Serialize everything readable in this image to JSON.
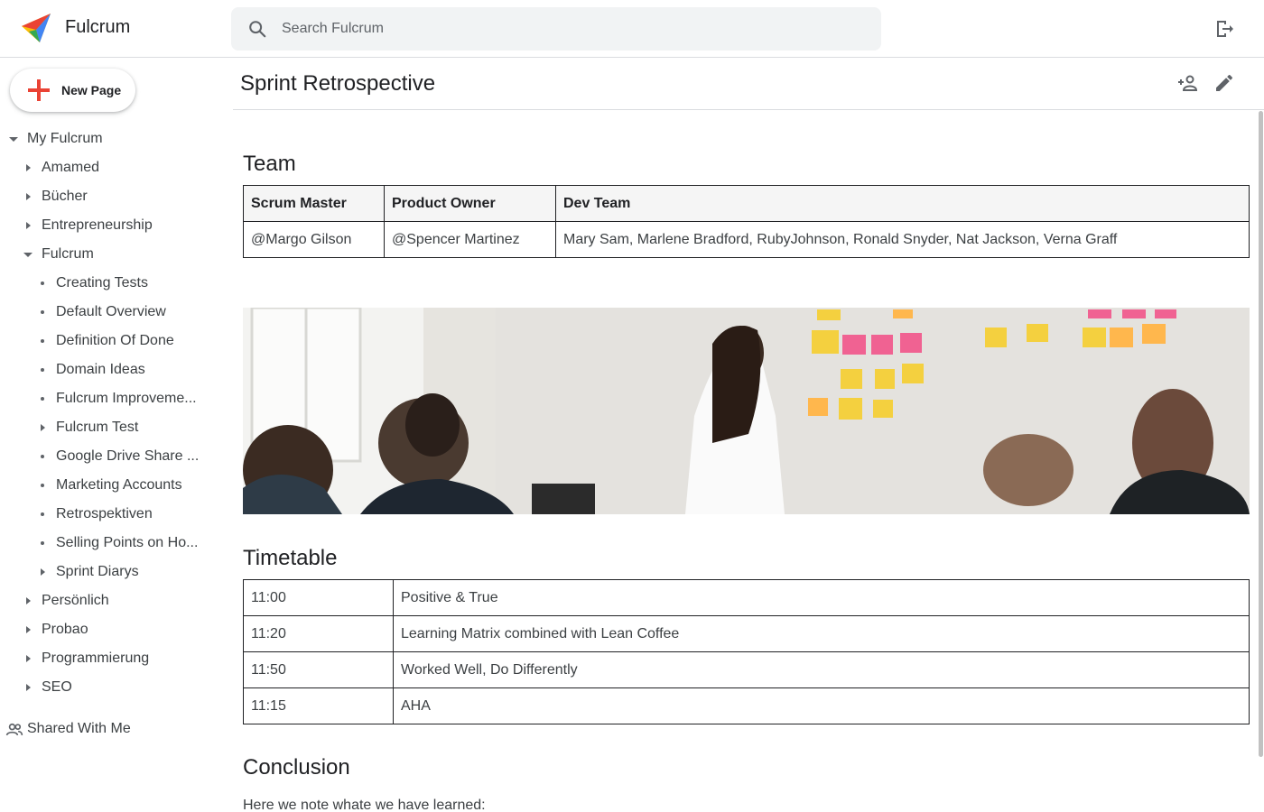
{
  "header": {
    "app_title": "Fulcrum",
    "search_placeholder": "Search Fulcrum",
    "logo_icon": "fulcrum-logo",
    "logout_icon": "logout-icon"
  },
  "sidebar": {
    "new_page_label": "New Page",
    "root_label": "My Fulcrum",
    "items": [
      {
        "label": "Amamed",
        "type": "collapsed"
      },
      {
        "label": "Bücher",
        "type": "collapsed"
      },
      {
        "label": "Entrepreneurship",
        "type": "collapsed"
      },
      {
        "label": "Fulcrum",
        "type": "expanded"
      },
      {
        "label": "Creating Tests",
        "type": "leaf"
      },
      {
        "label": "Default Overview",
        "type": "leaf"
      },
      {
        "label": "Definition Of Done",
        "type": "leaf"
      },
      {
        "label": "Domain Ideas",
        "type": "leaf"
      },
      {
        "label": "Fulcrum Improveme...",
        "type": "leaf"
      },
      {
        "label": "Fulcrum Test",
        "type": "collapsed"
      },
      {
        "label": "Google Drive Share ...",
        "type": "leaf"
      },
      {
        "label": "Marketing Accounts",
        "type": "leaf"
      },
      {
        "label": "Retrospektiven",
        "type": "leaf"
      },
      {
        "label": "Selling Points on Ho...",
        "type": "leaf"
      },
      {
        "label": "Sprint Diarys",
        "type": "collapsed"
      },
      {
        "label": "Persönlich",
        "type": "collapsed"
      },
      {
        "label": "Probao",
        "type": "collapsed"
      },
      {
        "label": "Programmierung",
        "type": "collapsed"
      },
      {
        "label": "SEO",
        "type": "collapsed"
      }
    ],
    "shared_label": "Shared With Me"
  },
  "page": {
    "title": "Sprint Retrospective",
    "team_heading": "Team",
    "team_headers": [
      "Scrum Master",
      "Product Owner",
      "Dev Team"
    ],
    "team_row": [
      "@Margo Gilson",
      "@Spencer Martinez",
      "Mary Sam, Marlene Bradford, RubyJohnson, Ronald Snyder, Nat Jackson, Verna Graff"
    ],
    "timetable_heading": "Timetable",
    "timetable": [
      [
        "11:00",
        "Positive & True"
      ],
      [
        "11:20",
        "Learning Matrix combined with Lean Coffee"
      ],
      [
        "11:50",
        "Worked Well, Do Differently"
      ],
      [
        "11:15",
        "AHA"
      ]
    ],
    "conclusion_heading": "Conclusion",
    "conclusion_text": "Here we note whate we have learned:"
  },
  "colors": {
    "accent_red": "#ea4335",
    "logo_blue": "#4285f4",
    "logo_green": "#34a853",
    "logo_yellow": "#fbbc05",
    "text_dark": "#202124",
    "text_body": "#3c4043"
  }
}
